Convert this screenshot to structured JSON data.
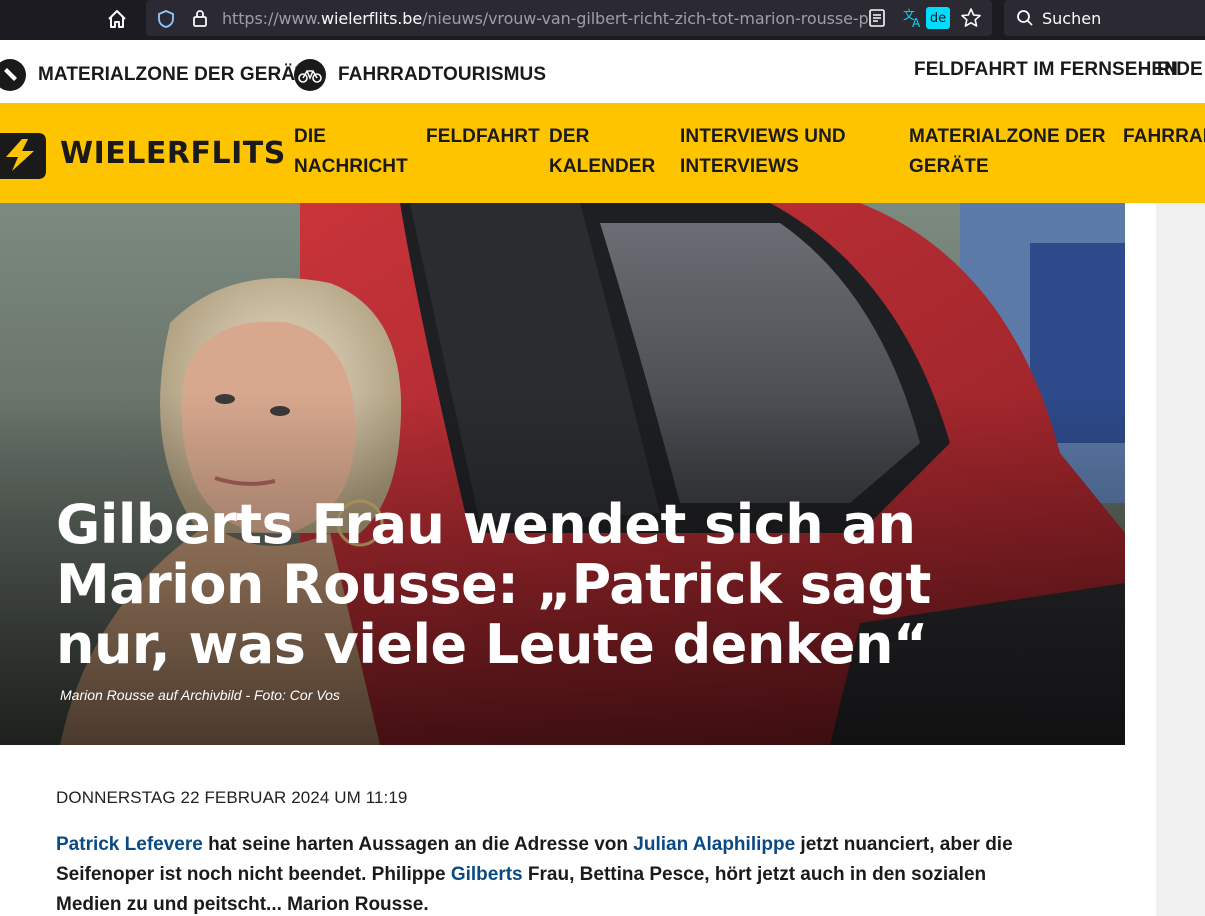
{
  "browser": {
    "url_prefix": "https://www.",
    "url_host": "wielerflits.be",
    "url_path": "/nieuws/vrouw-van-gilbert-richt-zich-tot-marion-rousse-p",
    "translate_lang": "de",
    "search_placeholder": "Suchen",
    "icons": [
      "home-icon",
      "shield-icon",
      "lock-icon",
      "reader-view-icon",
      "translate-icon",
      "bookmark-star-icon",
      "search-icon"
    ]
  },
  "utility_nav": {
    "items": [
      {
        "label": "MATERIALZONE DER GERÄTE",
        "icon": "tool-icon"
      },
      {
        "label": "FAHRRADTOURISMUS",
        "icon": "bicycle-icon"
      },
      {
        "label": "FELDFAHRT IM FERNSEHEN"
      },
      {
        "label": "RIDE N"
      }
    ]
  },
  "main_nav": {
    "logo_text": "WIELERFLITS",
    "items": [
      {
        "label": "DIE\nNACHRICHT"
      },
      {
        "label": "FELDFAHRT"
      },
      {
        "label": "DER\nKALENDER"
      },
      {
        "label": "INTERVIEWS UND\nINTERVIEWS"
      },
      {
        "label": "MATERIALZONE DER\nGERÄTE"
      },
      {
        "label": "FAHRRADT"
      }
    ]
  },
  "hero": {
    "title": "Gilberts Frau wendet sich an Marion Rousse: „Patrick sagt nur, was viele Leute denken“",
    "caption": "Marion Rousse auf Archivbild - Foto: Cor Vos"
  },
  "article": {
    "dateline": "DONNERSTAG 22 FEBRUAR 2024 UM 11:19",
    "lead": {
      "link1": "Patrick Lefevere",
      "text1": " hat seine harten Aussagen an die Adresse von ",
      "link2": "Julian Alaphilippe",
      "text2": " jetzt nuanciert, aber die Seifenoper ist noch nicht beendet. Philippe ",
      "link3": "Gilberts",
      "text3": " Frau, Bettina Pesce, hört jetzt auch in den sozialen Medien zu und peitscht... Marion Rousse."
    }
  },
  "colors": {
    "brand_yellow": "#ffc400",
    "link_blue": "#0a4a84",
    "browser_dark": "#1c1b22"
  }
}
